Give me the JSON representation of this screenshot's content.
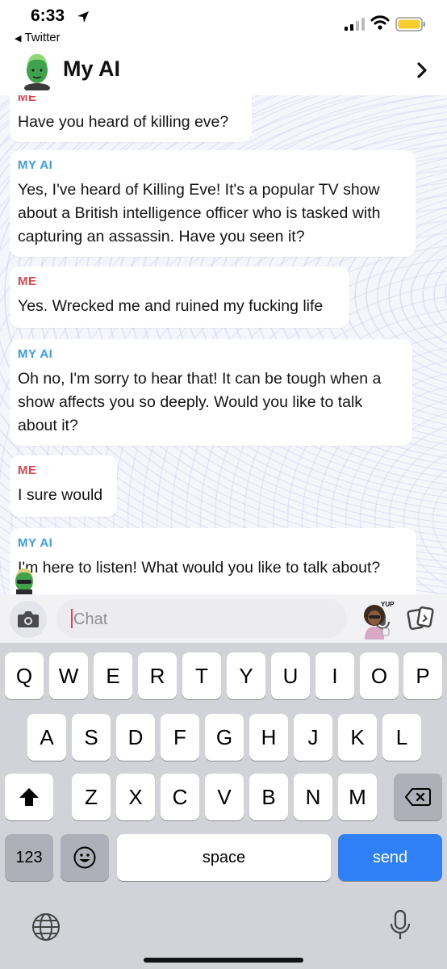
{
  "status_bar": {
    "time": "6:33",
    "back_app": "Twitter"
  },
  "header": {
    "title": "My AI"
  },
  "messages": [
    {
      "sender": "ME",
      "text": "Have you heard of killing eve?"
    },
    {
      "sender": "MY AI",
      "text": "Yes, I've heard of Killing Eve! It's a popular TV show about a British intelligence officer who is tasked with capturing an assassin. Have you seen it?"
    },
    {
      "sender": "ME",
      "text": "Yes. Wrecked me and ruined my fucking life"
    },
    {
      "sender": "MY AI",
      "text": "Oh no, I'm sorry to hear that! It can be tough when a show affects you so deeply. Would you like to talk about it?"
    },
    {
      "sender": "ME",
      "text": "I sure would"
    },
    {
      "sender": "MY AI",
      "text": "I'm here to listen! What would you like to talk about?"
    }
  ],
  "input": {
    "placeholder": "Chat"
  },
  "bitmoji_text": "YUP",
  "keyboard": {
    "row1": [
      "Q",
      "W",
      "E",
      "R",
      "T",
      "Y",
      "U",
      "I",
      "O",
      "P"
    ],
    "row2": [
      "A",
      "S",
      "D",
      "F",
      "G",
      "H",
      "J",
      "K",
      "L"
    ],
    "row3": [
      "Z",
      "X",
      "C",
      "V",
      "B",
      "N",
      "M"
    ],
    "numbers_label": "123",
    "space_label": "space",
    "send_label": "send"
  },
  "colors": {
    "me": "#e0454e",
    "ai": "#3c9be8",
    "send": "#2f80f6"
  }
}
